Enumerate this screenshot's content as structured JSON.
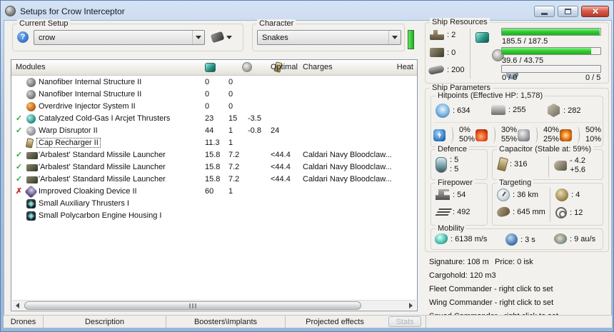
{
  "window": {
    "title": "Setups for Crow Interceptor"
  },
  "toolbar": {
    "current_setup_label": "Current Setup",
    "current_setup_value": "crow",
    "character_label": "Character",
    "character_value": "Snakes"
  },
  "ship_resources": {
    "label": "Ship Resources",
    "turrets": ": 2",
    "launchers": ": 0",
    "calibration": ": 200",
    "cpu_text": "185.5 / 187.5",
    "cpu_pct": 99,
    "powergrid_text": "39.6 / 43.75",
    "powergrid_pct": 90.5,
    "drones_text": "0 / 0",
    "drones_right": "0 / 5",
    "drones_pct": 0
  },
  "modules_table": {
    "header": {
      "modules": "Modules",
      "optimal": "Optimal",
      "charges": "Charges",
      "heat": "Heat"
    },
    "rows": [
      {
        "status": "none",
        "icon": "gear",
        "name": "Nanofiber Internal Structure II",
        "cpu": "0",
        "pg": "0",
        "cap": "",
        "optimal": "",
        "charges": ""
      },
      {
        "status": "none",
        "icon": "gear",
        "name": "Nanofiber Internal Structure II",
        "cpu": "0",
        "pg": "0",
        "cap": "",
        "optimal": "",
        "charges": ""
      },
      {
        "status": "none",
        "icon": "overdrive",
        "name": "Overdrive Injector System II",
        "cpu": "0",
        "pg": "0",
        "cap": "",
        "optimal": "",
        "charges": ""
      },
      {
        "status": "ok",
        "icon": "afterburner",
        "name": "Catalyzed Cold-Gas I Arcjet Thrusters",
        "cpu": "23",
        "pg": "15",
        "cap": "-3.5",
        "optimal": "",
        "charges": ""
      },
      {
        "status": "ok",
        "icon": "disruptor",
        "name": "Warp Disruptor II",
        "cpu": "44",
        "pg": "1",
        "cap": "-0.8",
        "optimal": "24",
        "charges": ""
      },
      {
        "status": "none",
        "icon": "battery",
        "name": "Cap Recharger II",
        "cpu": "11.3",
        "pg": "1",
        "cap": "",
        "optimal": "",
        "charges": "",
        "selected": "true"
      },
      {
        "status": "ok",
        "icon": "launcher",
        "name": "'Arbalest' Standard Missile Launcher",
        "cpu": "15.8",
        "pg": "7.2",
        "cap": "",
        "optimal": "<44.4",
        "charges": "Caldari Navy Bloodclaw..."
      },
      {
        "status": "ok",
        "icon": "launcher",
        "name": "'Arbalest' Standard Missile Launcher",
        "cpu": "15.8",
        "pg": "7.2",
        "cap": "",
        "optimal": "<44.4",
        "charges": "Caldari Navy Bloodclaw..."
      },
      {
        "status": "ok",
        "icon": "launcher",
        "name": "'Arbalest' Standard Missile Launcher",
        "cpu": "15.8",
        "pg": "7.2",
        "cap": "",
        "optimal": "<44.4",
        "charges": "Caldari Navy Bloodclaw..."
      },
      {
        "status": "off",
        "icon": "cloak",
        "name": "Improved Cloaking Device II",
        "cpu": "60",
        "pg": "1",
        "cap": "",
        "optimal": "",
        "charges": ""
      },
      {
        "status": "none",
        "icon": "rig",
        "name": "Small Auxiliary Thrusters I",
        "cpu": "",
        "pg": "",
        "cap": "",
        "optimal": "",
        "charges": ""
      },
      {
        "status": "none",
        "icon": "rig",
        "name": "Small Polycarbon Engine Housing I",
        "cpu": "",
        "pg": "",
        "cap": "",
        "optimal": "",
        "charges": ""
      }
    ]
  },
  "ship_parameters": {
    "label": "Ship Parameters",
    "hitpoints": {
      "label": "Hitpoints (Effective HP: 1,578)",
      "shield": ": 634",
      "armor": ": 255",
      "hull": ": 282",
      "resists": [
        {
          "top": "0%",
          "bottom": "50%"
        },
        {
          "top": "30%",
          "bottom": "55%"
        },
        {
          "top": "40%",
          "bottom": "25%"
        },
        {
          "top": "50%",
          "bottom": "10%"
        }
      ]
    },
    "defence": {
      "label": "Defence",
      "v1": ": 5",
      "v2": ": 5"
    },
    "capacitor": {
      "label": "Capacitor (Stable at: 59%)",
      "amount": ": 316",
      "neg": "- 4.2",
      "pos": "+5.6"
    },
    "firepower": {
      "label": "Firepower",
      "volley": ": 54",
      "dps": ": 492"
    },
    "targeting": {
      "label": "Targeting",
      "range": ": 36 km",
      "max_targets": ": 4",
      "signature": ": 645 mm",
      "scan_res": ": 12"
    },
    "mobility": {
      "label": "Mobility",
      "speed": ": 6138 m/s",
      "align": ": 3 s",
      "warp": ": 9 au/s"
    },
    "info": {
      "signature": "Signature: 108 m",
      "price": "Price: 0 isk",
      "cargohold": "Cargohold: 120 m3",
      "fleet": "Fleet Commander - right click to set",
      "wing": "Wing Commander - right click to set",
      "squad": "Squad Commander - right click to set"
    }
  },
  "bottom_bar": {
    "tabs": [
      {
        "label": "Drones"
      },
      {
        "label": "Description"
      },
      {
        "label": "Boosters\\Implants"
      },
      {
        "label": "Projected effects"
      }
    ],
    "stats_button": "Stats"
  }
}
